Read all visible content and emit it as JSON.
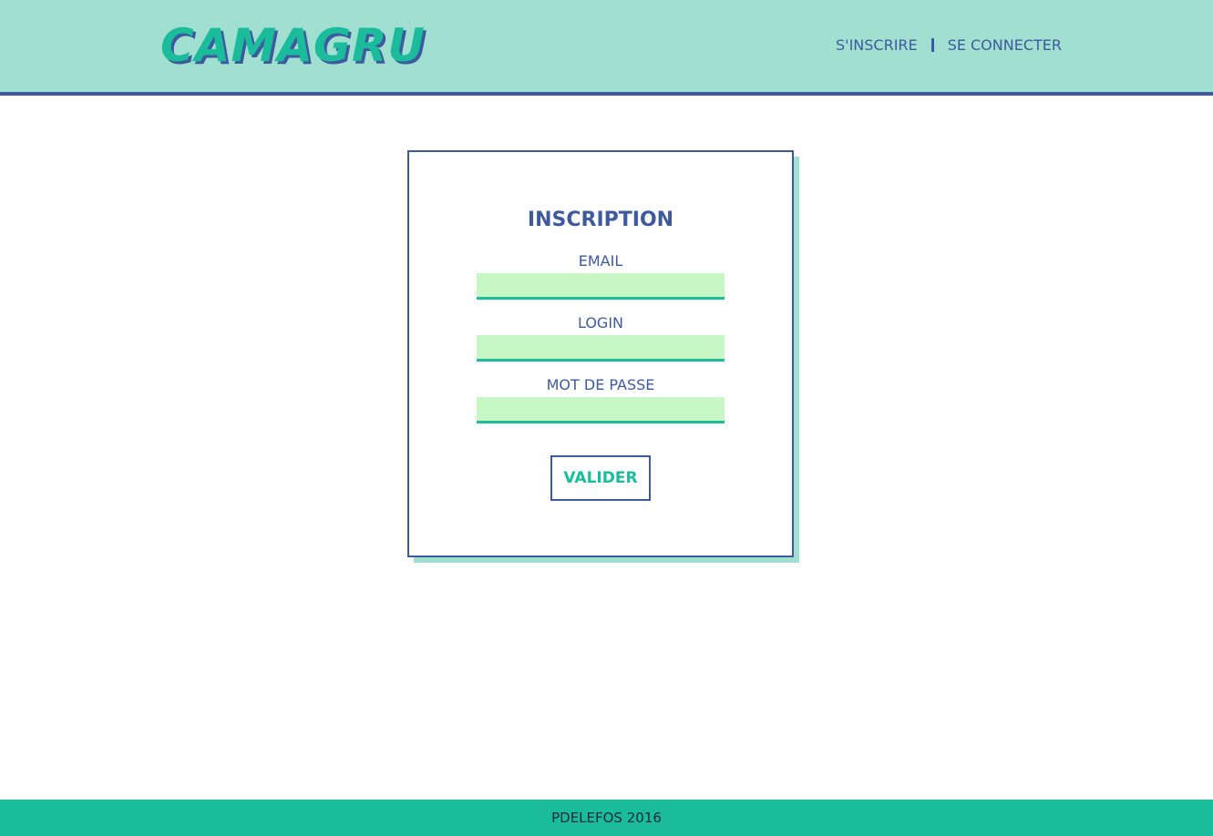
{
  "header": {
    "logo_text": "CAMAGRU",
    "nav": {
      "signup_label": "S'INSCRIRE",
      "login_label": "SE CONNECTER"
    }
  },
  "form": {
    "title": "INSCRIPTION",
    "fields": [
      {
        "label": "EMAIL",
        "value": ""
      },
      {
        "label": "LOGIN",
        "value": ""
      },
      {
        "label": "MOT DE PASSE",
        "value": ""
      }
    ],
    "submit_label": "VALIDER"
  },
  "footer": {
    "text": "PDELEFOS 2016"
  },
  "colors": {
    "header_bg": "#a1dfd1",
    "accent_blue": "#3d5a9e",
    "accent_green": "#1abc9c",
    "input_bg": "#c7f7c4"
  }
}
